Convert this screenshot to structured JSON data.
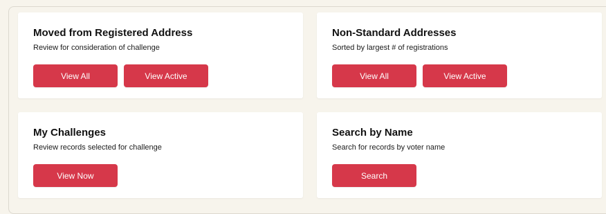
{
  "cards": [
    {
      "title": "Moved from Registered Address",
      "description": "Review for consideration of challenge",
      "buttons": [
        "View All",
        "View Active"
      ]
    },
    {
      "title": "Non-Standard Addresses",
      "description": "Sorted by largest # of registrations",
      "buttons": [
        "View All",
        "View Active"
      ]
    },
    {
      "title": "My Challenges",
      "description": "Review records selected for challenge",
      "buttons": [
        "View Now"
      ]
    },
    {
      "title": "Search by Name",
      "description": "Search for records by voter name",
      "buttons": [
        "Search"
      ]
    }
  ],
  "colors": {
    "button": "#d6384a",
    "background": "#f7f4ec",
    "card": "#ffffff"
  }
}
